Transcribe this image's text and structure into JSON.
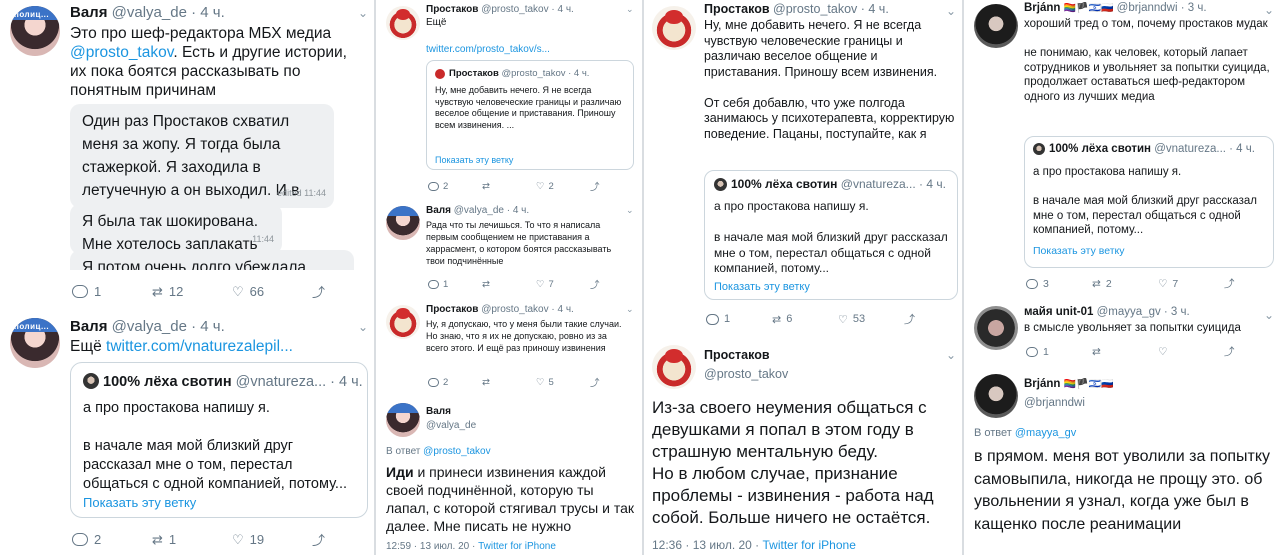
{
  "panel1": {
    "tweet1": {
      "avatar_tag": "полиц...",
      "name": "Валя",
      "handle": "@valya_de · 4 ч.",
      "text": "Это про шеф-редактора МБХ медиа",
      "mention": "@prosto_takov",
      "text2": ". Есть и другие истории, их пока боятся рассказывать по понятным причинам",
      "chat": {
        "msg1": "Один раз Простаков схватил меня за жопу. Я тогда была стажеркой. Я заходила в летучечную а он выходил. И в этом дверном проеме он схватил меня за ягодицу",
        "msg1_time": "edited 11:44",
        "msg2": "Я была так шокирована. Мне хотелось заплакать",
        "msg2_time": "11:44",
        "msg3": "Я потом очень долго убеждала себя"
      },
      "replies": "1",
      "retweets": "12",
      "likes": "66"
    },
    "tweet2": {
      "avatar_tag": "полиц...",
      "name": "Валя",
      "handle": "@valya_de · 4 ч.",
      "text": "Ещё",
      "link": "twitter.com/vnaturezalepil...",
      "quote": {
        "name": "100% лёха свотин",
        "handle": "@vnatureza... · 4 ч.",
        "text": "а про простакова напишу я.\n\nв начале мая мой близкий друг рассказал мне о том, перестал общаться с одной компанией, потому...",
        "show_thread": "Показать эту ветку"
      },
      "replies": "2",
      "retweets": "1",
      "likes": "19"
    }
  },
  "panel2": {
    "tweet1": {
      "name": "Простаков",
      "handle": "@prosto_takov · 4 ч.",
      "text": "Ещё",
      "link": "twitter.com/prosto_takov/s...",
      "quote": {
        "name": "Простаков",
        "handle": "@prosto_takov · 4 ч.",
        "text": "Ну, мне добавить нечего. Я не всегда чувствую человеческие границы и различаю веселое общение и приставания. Приношу всем извинения. ...",
        "show_thread": "Показать эту ветку"
      },
      "replies": "2",
      "likes": "2"
    },
    "tweet2": {
      "name": "Валя",
      "handle": "@valya_de · 4 ч.",
      "text": "Рада что ты лечишься. То что я написала первым сообщением не приставания а харрасмент, о котором боятся рассказывать твои подчинённые",
      "replies": "1",
      "likes": "7"
    },
    "tweet3": {
      "name": "Простаков",
      "handle": "@prosto_takov · 4 ч.",
      "text": "Ну, я допускаю, что у меня были такие случаи. Но знаю, что я их не допускаю, ровно из за всего этого. И ещё раз приношу извинения",
      "replies": "2",
      "likes": "5"
    },
    "tweet4": {
      "name": "Валя",
      "handle": "@valya_de",
      "reply_prefix": "В ответ",
      "reply_to": "@prosto_takov",
      "text_bold": "Иди",
      "text": " и принеси извинения каждой своей подчинённой, которую ты лапал, с которой стягивал трусы и так далее. Мне писать не нужно",
      "time": "12:59 · 13 июл. 20 · ",
      "source": "Twitter for iPhone"
    }
  },
  "panel3": {
    "tweet1": {
      "name": "Простаков",
      "handle": "@prosto_takov · 4 ч.",
      "text": "Ну, мне добавить нечего. Я не всегда чувствую человеческие границы и различаю веселое общение и приставания. Приношу всем извинения.\n\nОт себя добавлю, что уже полгода занимаюсь у психотерапевта, корректирую поведение. Пацаны, поступайте, как я",
      "quote": {
        "name": "100% лёха свотин",
        "handle": "@vnatureza... · 4 ч.",
        "text": "а про простакова напишу я.\n\nв начале мая мой близкий друг рассказал мне о том, перестал общаться с одной компанией, потому...",
        "show_thread": "Показать эту ветку"
      },
      "replies": "1",
      "retweets": "6",
      "likes": "53"
    },
    "tweet2": {
      "name": "Простаков",
      "handle": "@prosto_takov",
      "text": "Из-за своего неумения общаться с девушками я попал в этом году в страшную ментальную беду.\nНо в любом случае, признание проблемы - извинения - работа над собой. Больше ничего не остаётся.",
      "time": "12:36 · 13 июл. 20 · ",
      "source": "Twitter for iPhone"
    }
  },
  "panel4": {
    "tweet1": {
      "name": "Brjánn",
      "flags": "🏳️‍🌈🏴🇮🇱🇷🇺",
      "handle": "@brjanndwi · 3 ч.",
      "text": "хороший тред о том, почему простаков мудак\n\nне понимаю, как человек, который лапает сотрудников и увольняет за попытки суицида, продолжает оставаться шеф-редактором одного из лучших медиа",
      "quote": {
        "name": "100% лёха свотин",
        "handle": "@vnatureza... · 4 ч.",
        "text": "а про простакова напишу я.\n\nв начале мая мой близкий друг рассказал мне о том, перестал общаться с одной компанией, потому...",
        "show_thread": "Показать эту ветку"
      },
      "replies": "3",
      "retweets": "2",
      "likes": "7"
    },
    "tweet2": {
      "name": "майя unit-01",
      "handle": "@mayya_gv · 3 ч.",
      "text": "в смысле увольняет за попытки суицида",
      "replies": "1"
    },
    "tweet3": {
      "name": "Brjánn",
      "flags": "🏳️‍🌈🏴🇮🇱🇷🇺",
      "handle": "@brjanndwi",
      "reply_prefix": "В ответ",
      "reply_to": "@mayya_gv",
      "text": "в прямом. меня вот уволили за попытку самовыпила, никогда не прощу это. об увольнении я узнал, когда уже был в кащенко после реанимации"
    }
  }
}
